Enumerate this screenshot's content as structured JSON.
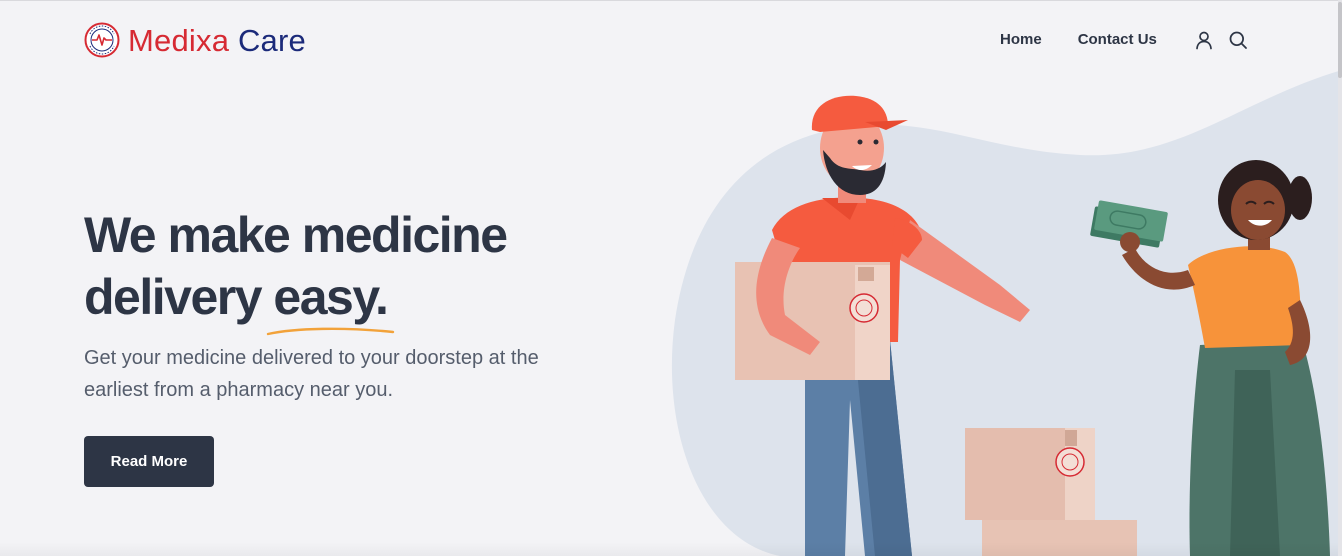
{
  "brand": {
    "name_part1": "Medixa",
    "name_part2": "Care",
    "logo_icon": "medixa-care-seal-logo"
  },
  "nav": {
    "items": [
      {
        "label": "Home"
      },
      {
        "label": "Contact Us"
      }
    ],
    "icons": [
      "user-icon",
      "search-icon"
    ]
  },
  "hero": {
    "title_line1": "We make medicine",
    "title_line2_start": "delivery",
    "title_highlight": "easy.",
    "subtitle": "Get your medicine delivered to your doorstep at the earliest from a pharmacy near you.",
    "cta_label": "Read More"
  },
  "colors": {
    "background": "#f3f3f6",
    "text_dark": "#2d3545",
    "brand_red": "#d62a33",
    "brand_navy": "#1b2a7a",
    "underline_orange": "#f2a23a",
    "button_bg": "#2d3545"
  }
}
